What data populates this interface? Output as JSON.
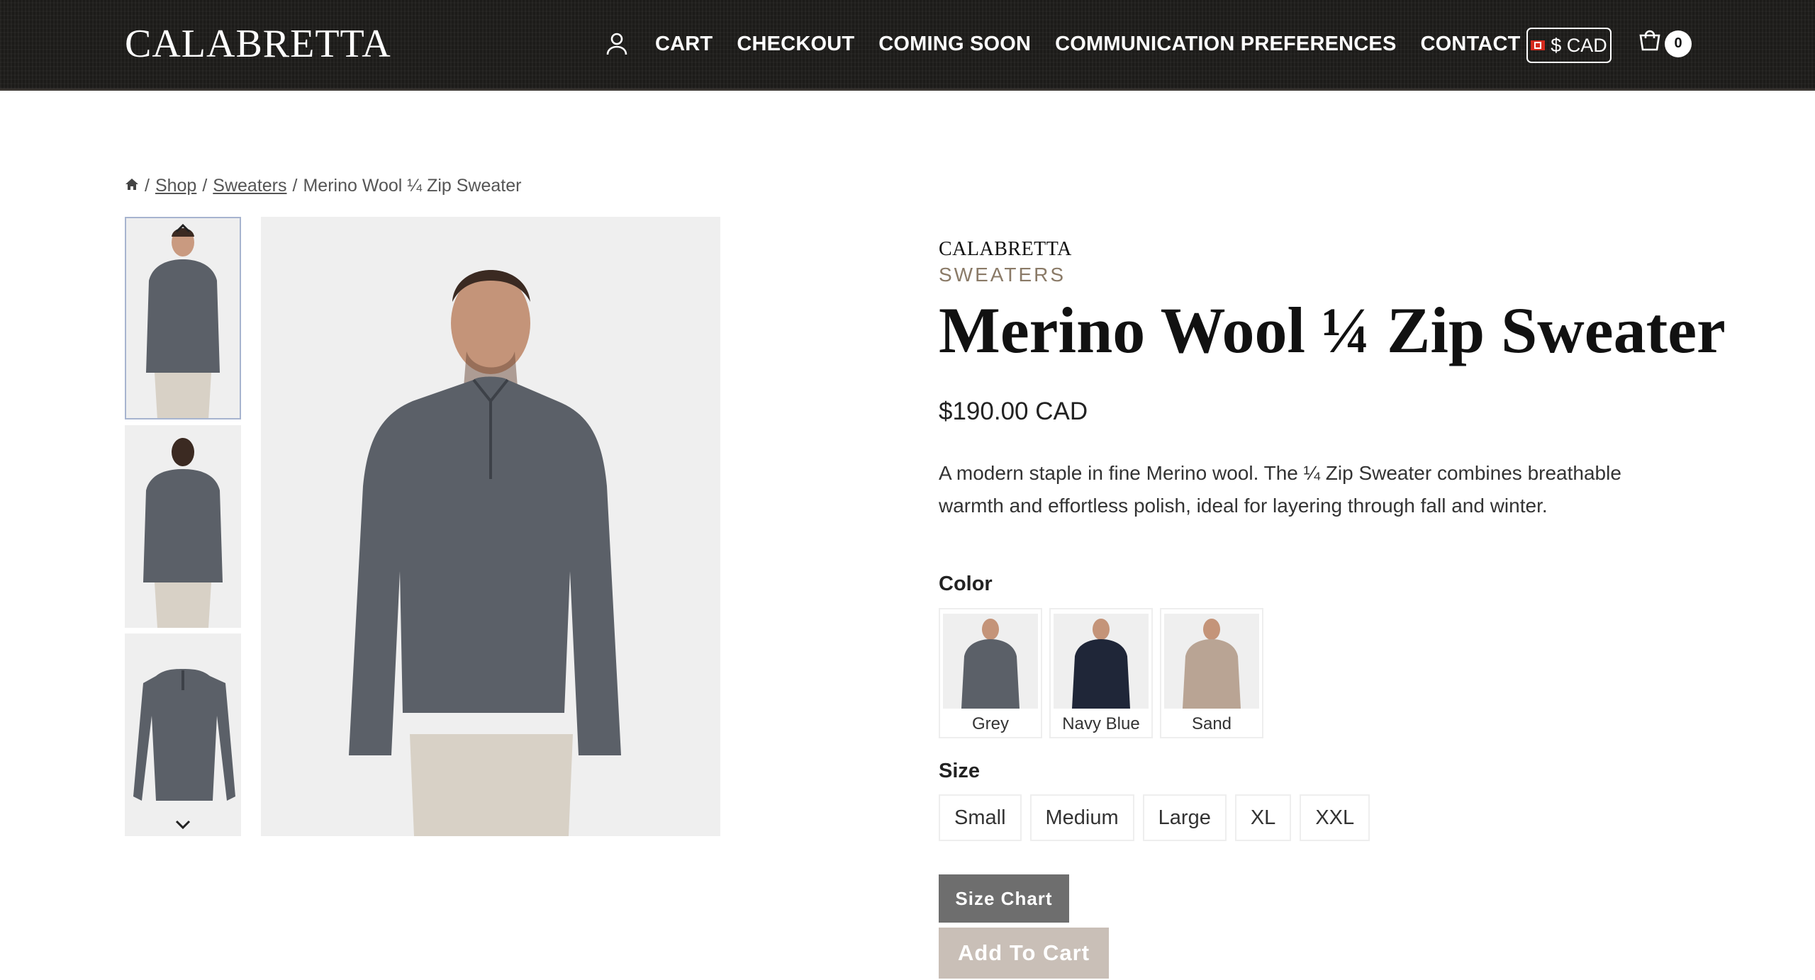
{
  "header": {
    "logo": "CALABRETTA",
    "nav": [
      "CART",
      "CHECKOUT",
      "COMING SOON",
      "COMMUNICATION PREFERENCES",
      "CONTACT"
    ],
    "currency": "$ CAD",
    "cart_count": "0",
    "icons": [
      "user-icon",
      "flag-canada-icon",
      "cart-icon"
    ]
  },
  "breadcrumb": {
    "home_icon": "home-icon",
    "shop": "Shop",
    "sweaters": "Sweaters",
    "current": "Merino Wool ¼ Zip Sweater",
    "separator": "/"
  },
  "product": {
    "brand": "CALABRETTA",
    "category": "SWEATERS",
    "title": "Merino Wool ¼ Zip Sweater",
    "price": "$190.00 CAD",
    "description": "A modern staple in fine Merino wool. The ¼ Zip Sweater combines breathable warmth and effortless polish, ideal for layering through fall and winter.",
    "color_label": "Color",
    "colors": [
      {
        "name": "Grey",
        "hex": "#5b6068"
      },
      {
        "name": "Navy Blue",
        "hex": "#1f2638"
      },
      {
        "name": "Sand",
        "hex": "#b9a494"
      }
    ],
    "size_label": "Size",
    "sizes": [
      "Small",
      "Medium",
      "Large",
      "XL",
      "XXL"
    ],
    "size_chart_button": "Size Chart",
    "add_to_cart_button": "Add To Cart"
  },
  "gallery": {
    "thumb_up_icon": "chevron-up-icon",
    "thumb_down_icon": "chevron-down-icon"
  }
}
